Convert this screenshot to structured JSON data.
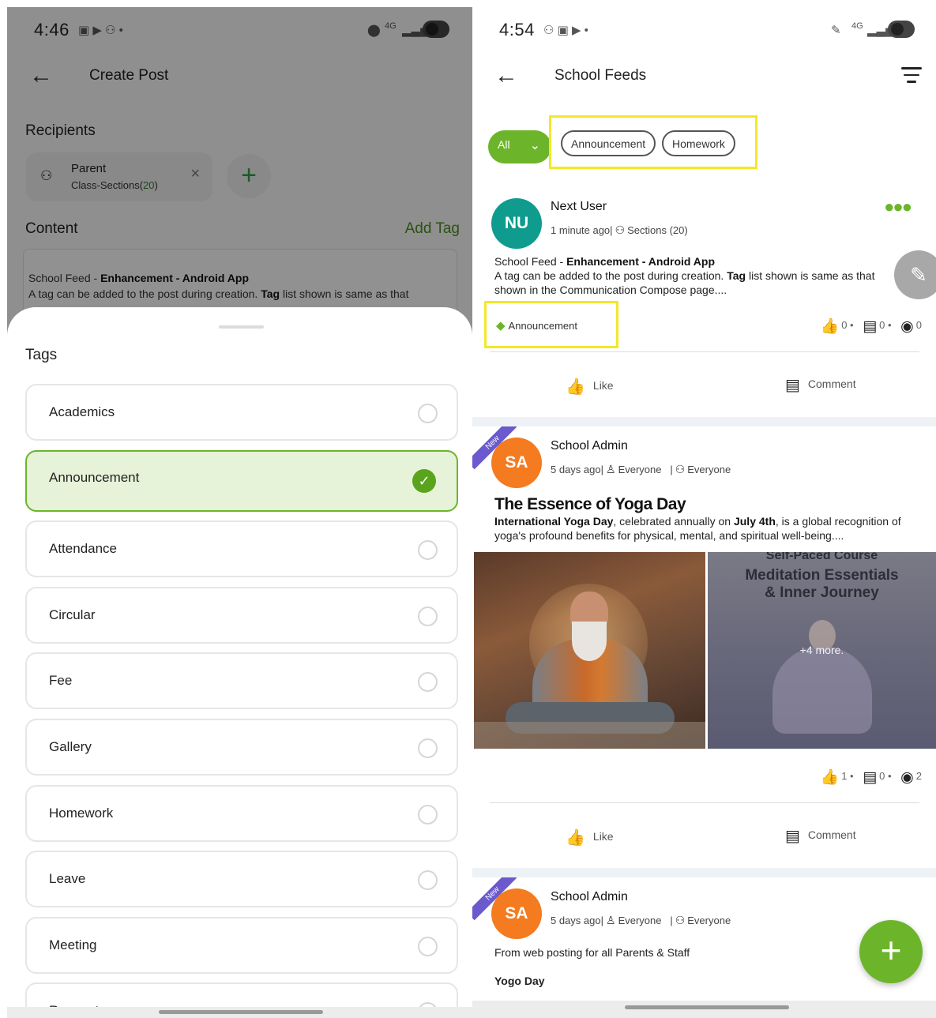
{
  "left": {
    "status": {
      "time": "4:46",
      "network": "4G"
    },
    "appbar": {
      "title": "Create Post"
    },
    "recipients": {
      "label": "Recipients",
      "chip": {
        "name": "Parent",
        "detail_prefix": "Class-Sections(",
        "count": "20",
        "detail_suffix": ")"
      },
      "add_symbol": "+",
      "remove_symbol": "×"
    },
    "content": {
      "label": "Content",
      "add_tag": "Add Tag",
      "text_prefix": "School Feed - ",
      "text_bold": "Enhancement - Android App",
      "line2_start": "A tag can be added to the post during creation. ",
      "line2_bold": "Tag",
      "line2_end": " list shown is same as that"
    },
    "sheet": {
      "title": "Tags",
      "tags": [
        {
          "label": "Academics",
          "selected": false
        },
        {
          "label": "Announcement",
          "selected": true
        },
        {
          "label": "Attendance",
          "selected": false
        },
        {
          "label": "Circular",
          "selected": false
        },
        {
          "label": "Fee",
          "selected": false
        },
        {
          "label": "Gallery",
          "selected": false
        },
        {
          "label": "Homework",
          "selected": false
        },
        {
          "label": "Leave",
          "selected": false
        },
        {
          "label": "Meeting",
          "selected": false
        },
        {
          "label": "Request",
          "selected": false
        }
      ]
    }
  },
  "right": {
    "status": {
      "time": "4:54",
      "network": "4G"
    },
    "appbar": {
      "title": "School Feeds"
    },
    "filters": {
      "all": "All",
      "chips": [
        "Announcement",
        "Homework"
      ]
    },
    "posts": [
      {
        "avatar": "NU",
        "avatar_color": "#0f9b8e",
        "name": "Next User",
        "time": "1 minute ago",
        "audience": "Sections (20)",
        "body_prefix": "School Feed - ",
        "body_bold": "Enhancement - Android App",
        "body_line2_start": "A tag can be added to the post during creation. ",
        "body_line2_bold": "Tag",
        "body_line2_end": " list shown is same as that shown in the Communication Compose page....",
        "tag": "Announcement",
        "likes": "0",
        "comments": "0",
        "views": "0"
      },
      {
        "badge": "New",
        "avatar": "SA",
        "avatar_color": "#f47b20",
        "name": "School Admin",
        "time": "5 days ago",
        "audience1": "Everyone",
        "audience2": "Everyone",
        "title": "The Essence of Yoga Day",
        "body_bold1": "International Yoga Day",
        "body_mid": ", celebrated annually on ",
        "body_bold2": "July 4th",
        "body_end": ", is a global recognition of yoga's profound benefits for physical, mental, and spiritual well-being....",
        "image_caption_top": "Self-Paced Course",
        "image_caption_main1": "Meditation Essentials",
        "image_caption_main2": "& Inner Journey",
        "more": "+4 more.",
        "likes": "1",
        "comments": "0",
        "views": "2"
      },
      {
        "badge": "New",
        "avatar": "SA",
        "avatar_color": "#f47b20",
        "name": "School Admin",
        "time": "5 days ago",
        "audience1": "Everyone",
        "audience2": "Everyone",
        "body": "From web posting for all Parents & Staff",
        "subtitle": "Yogo Day"
      }
    ],
    "actions": {
      "like": "Like",
      "comment": "Comment"
    },
    "colors": {
      "accent": "#6cb52a",
      "highlight": "#f4e72a"
    }
  }
}
